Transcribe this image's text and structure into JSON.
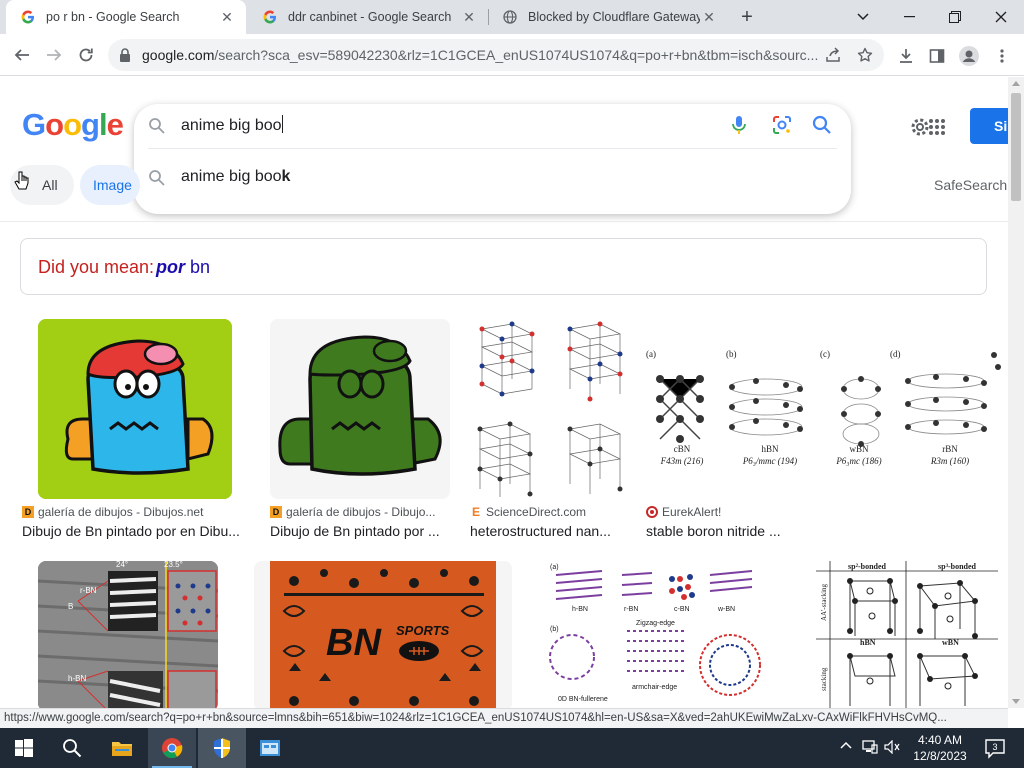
{
  "browser": {
    "tabs": [
      {
        "title": "po r bn - Google Search",
        "active": true
      },
      {
        "title": "ddr canbinet - Google Search",
        "active": false
      },
      {
        "title": "Blocked by Cloudflare Gateway",
        "active": false
      }
    ],
    "new_tab": "+",
    "url": "google.com/search?sca_esv=589042230&rlz=1C1GCEA_enUS1074US1074&q=po+r+bn&tbm=isch&sourc...",
    "url_domain": "google.com",
    "url_rest": "/search?sca_esv=589042230&rlz=1C1GCEA_enUS1074US1074&q=po+r+bn&tbm=isch&sourc..."
  },
  "google": {
    "logo_letters": [
      "G",
      "o",
      "o",
      "g",
      "l",
      "e"
    ],
    "logo_colors": [
      "#4285f4",
      "#ea4335",
      "#fbbc05",
      "#4285f4",
      "#34a853",
      "#ea4335"
    ],
    "query": "anime big boo",
    "suggestion_prefix": "anime big boo",
    "suggestion_bold": "k",
    "signin_label": "Si",
    "chips": {
      "all": "All",
      "images": "Image"
    },
    "safesearch": "SafeSearch",
    "did_you_mean_label": "Did you mean:",
    "did_you_mean_bold": "por",
    "did_you_mean_rest": " bn"
  },
  "results_row1": [
    {
      "source": "galería de dibujos - Dibujos.net",
      "caption": "Dibujo de Bn pintado por en Dibu...",
      "source_icon": "D"
    },
    {
      "source": "galería de dibujos - Dibujo...",
      "caption": "Dibujo de Bn pintado por ...",
      "source_icon": "D"
    },
    {
      "source": "ScienceDirect.com",
      "caption": "heterostructured nan...",
      "source_icon": "E"
    },
    {
      "source": "EurekAlert!",
      "caption": "stable boron nitride ...",
      "source_icon": "eurekalert-icon"
    }
  ],
  "image_labels": {
    "crystal_labels": [
      "(a)",
      "(b)",
      "(c)",
      "(d)"
    ],
    "crystal_names": [
      "cBN",
      "hBN",
      "wBN",
      "rBN"
    ],
    "crystal_groups": [
      "F43m (216)",
      "P6₃/mmc (194)",
      "P6₃mc (186)",
      "R3m (160)"
    ],
    "bn_sports": "BN",
    "bn_sports_sub": "SPORTS",
    "sp_left": "sp²-bonded",
    "sp_right": "sp³-bonded",
    "sp_hbn": "hBN",
    "sp_wbn": "wBN",
    "sp_aa": "AA'-stacking",
    "sp_stack": "stacking",
    "nano_labels": [
      "h-BN",
      "r-BN",
      "c-BN",
      "w-BN"
    ],
    "nano_b": "(b)",
    "nano_a": "(a)",
    "nano_fullerene": "0D BN-fullerene",
    "nano_zigzag": "Zigzag-edge",
    "nano_armchair": "armchair-edge",
    "tem_labels": [
      "r-BN",
      "B",
      "h-BN",
      "24°",
      "23.5°"
    ]
  },
  "status_url": "https://www.google.com/search?q=po+r+bn&source=lmns&bih=651&biw=1024&rlz=1C1GCEA_enUS1074US1074&hl=en-US&sa=X&ved=2ahUKEwiMwZaLxv-CAxWiFlkFHVHsCvMQ...",
  "taskbar": {
    "time": "4:40 AM",
    "date": "12/8/2023",
    "notifications": "3"
  }
}
